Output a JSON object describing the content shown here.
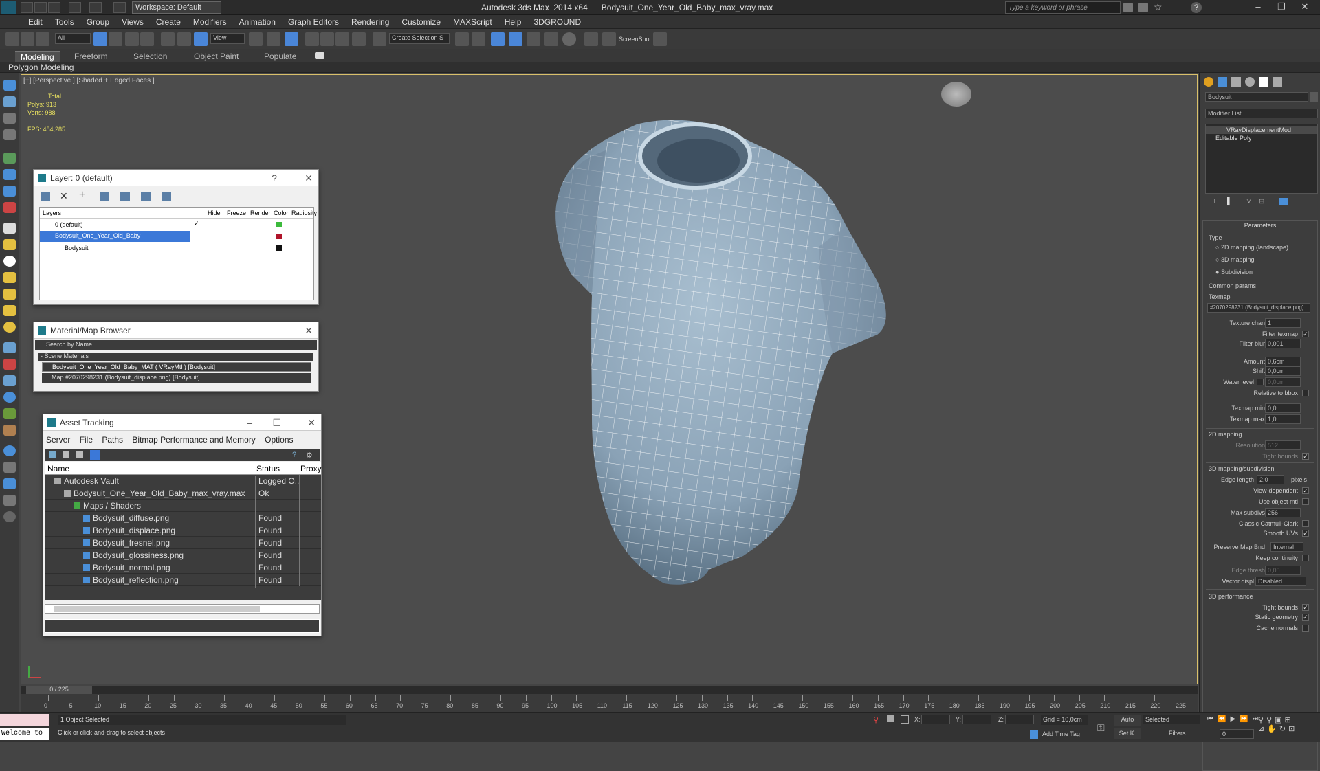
{
  "titlebar": {
    "workspace": "Workspace: Default",
    "app": "Autodesk 3ds Max  2014 x64",
    "file": "Bodysuit_One_Year_Old_Baby_max_vray.max",
    "search_placeholder": "Type a keyword or phrase"
  },
  "menu": [
    "Edit",
    "Tools",
    "Group",
    "Views",
    "Create",
    "Modifiers",
    "Animation",
    "Graph Editors",
    "Rendering",
    "Customize",
    "MAXScript",
    "Help",
    "3DGROUND"
  ],
  "toolbar": {
    "filter": "All",
    "refcoord": "View",
    "selection_set": "Create Selection S",
    "screenshot": "ScreenShot"
  },
  "ribbon": {
    "tabs": [
      "Modeling",
      "Freeform",
      "Selection",
      "Object Paint",
      "Populate"
    ],
    "subtab": "Polygon Modeling"
  },
  "viewport": {
    "label": "[+] [Perspective ] [Shaded + Edged Faces ]",
    "stats_total": "Total",
    "polys": "Polys:  913",
    "verts": "Verts:  988",
    "fps": "FPS:     484,285"
  },
  "layer_panel": {
    "title": "Layer: 0 (default)",
    "columns": [
      "Layers",
      "Hide",
      "Freeze",
      "Render",
      "Color",
      "Radiosity"
    ],
    "rows": [
      {
        "name": "0 (default)",
        "color": "#3cba3c"
      },
      {
        "name": "Bodysuit_One_Year_Old_Baby",
        "color": "#b0142a"
      },
      {
        "name": "Bodysuit",
        "color": "#111111"
      }
    ]
  },
  "material_panel": {
    "title": "Material/Map Browser",
    "search": "Search by Name ...",
    "section": "- Scene Materials",
    "items": [
      "Bodysuit_One_Year_Old_Baby_MAT ( VRayMtl ) [Bodysuit]",
      "Map #2070298231 (Bodysuit_displace.png) [Bodysuit]"
    ]
  },
  "asset_panel": {
    "title": "Asset Tracking",
    "menu": [
      "Server",
      "File",
      "Paths",
      "Bitmap Performance and Memory",
      "Options"
    ],
    "columns": [
      "Name",
      "Status",
      "Proxy"
    ],
    "rows": [
      {
        "name": "Autodesk Vault",
        "status": "Logged O...",
        "indent": 1
      },
      {
        "name": "Bodysuit_One_Year_Old_Baby_max_vray.max",
        "status": "Ok",
        "indent": 2
      },
      {
        "name": "Maps / Shaders",
        "status": "",
        "indent": 3
      },
      {
        "name": "Bodysuit_diffuse.png",
        "status": "Found",
        "indent": 4
      },
      {
        "name": "Bodysuit_displace.png",
        "status": "Found",
        "indent": 4
      },
      {
        "name": "Bodysuit_fresnel.png",
        "status": "Found",
        "indent": 4
      },
      {
        "name": "Bodysuit_glossiness.png",
        "status": "Found",
        "indent": 4
      },
      {
        "name": "Bodysuit_normal.png",
        "status": "Found",
        "indent": 4
      },
      {
        "name": "Bodysuit_reflection.png",
        "status": "Found",
        "indent": 4
      }
    ]
  },
  "command_panel": {
    "object_name": "Bodysuit",
    "modifier_list": "Modifier List",
    "stack": [
      "VRayDisplacementMod",
      "Editable Poly"
    ],
    "parameters": "Parameters",
    "type_label": "Type",
    "types": [
      "2D mapping (landscape)",
      "3D mapping",
      "Subdivision"
    ],
    "common": "Common params",
    "texmap_label": "Texmap",
    "texmap": "#2070298231 (Bodysuit_displace.png)",
    "texture_chan": {
      "label": "Texture chan",
      "value": "1"
    },
    "filter_texmap": "Filter texmap",
    "filter_blur": {
      "label": "Filter blur",
      "value": "0,001"
    },
    "amount": {
      "label": "Amount",
      "value": "0,6cm"
    },
    "shift": {
      "label": "Shift",
      "value": "0,0cm"
    },
    "water": {
      "label": "Water level",
      "value": "0,0cm"
    },
    "rel_bbox": "Relative to bbox",
    "texmap_min": {
      "label": "Texmap min",
      "value": "0,0"
    },
    "texmap_max": {
      "label": "Texmap max",
      "value": "1,0"
    },
    "mapping2d": "2D mapping",
    "resolution": {
      "label": "Resolution",
      "value": "512"
    },
    "tight_bounds": "Tight bounds",
    "mapping3d": "3D mapping/subdivision",
    "edge_length": {
      "label": "Edge length",
      "value": "2,0",
      "unit": "pixels"
    },
    "view_dependent": "View-dependent",
    "use_object_mtl": "Use object mtl",
    "max_subdivs": {
      "label": "Max subdivs",
      "value": "256"
    },
    "catmull": "Classic Catmull-Clark",
    "smooth_uvs": "Smooth UVs",
    "preserve_map": {
      "label": "Preserve Map Bnd",
      "value": "Internal"
    },
    "keep_continuity": "Keep continuity",
    "edge_thresh": {
      "label": "Edge thresh",
      "value": "0,05"
    },
    "vector_disp": {
      "label": "Vector displ",
      "value": "Disabled"
    },
    "perf": "3D performance",
    "tight_bounds2": "Tight bounds",
    "static_geometry": "Static geometry",
    "cache_normals": "Cache normals"
  },
  "timeline": {
    "frame": "0 / 225",
    "ticks": [
      "0",
      "5",
      "10",
      "15",
      "20",
      "25",
      "30",
      "35",
      "40",
      "45",
      "50",
      "55",
      "60",
      "65",
      "70",
      "75",
      "80",
      "85",
      "90",
      "95",
      "100",
      "105",
      "110",
      "115",
      "120",
      "125",
      "130",
      "135",
      "140",
      "145",
      "150",
      "155",
      "160",
      "165",
      "170",
      "175",
      "180",
      "185",
      "190",
      "195",
      "200",
      "205",
      "210",
      "215",
      "220",
      "225"
    ]
  },
  "status": {
    "listener": "Welcome to",
    "selected": "1 Object Selected",
    "hint": "Click or click-and-drag to select objects",
    "x": "X:",
    "y": "Y:",
    "z": "Z:",
    "grid": "Grid = 10,0cm",
    "add_time_tag": "Add Time Tag",
    "auto": "Auto",
    "setk": "Set K.",
    "selected_dd": "Selected",
    "filters": "Filters...",
    "frame_field": "0"
  },
  "colors": {
    "viewport_bg": "#4c4c4c",
    "selection_blue": "#3b78d8",
    "mesh": "#8ea5b8"
  }
}
